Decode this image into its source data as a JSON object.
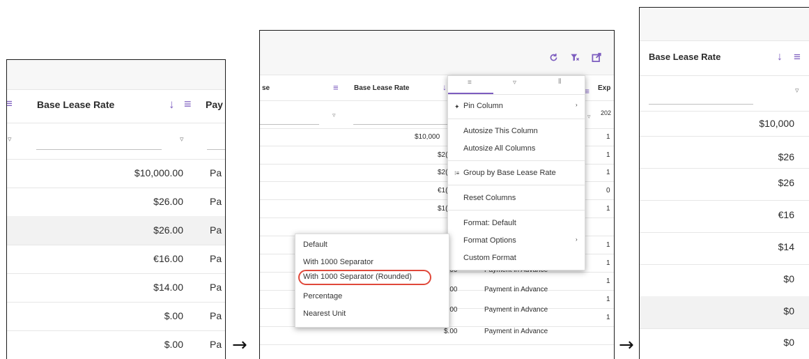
{
  "colors": {
    "accent": "#7c5cbf",
    "highlight_oval": "#e0483a"
  },
  "panel1": {
    "header": {
      "col_fragment_left": "≡",
      "col_title": "Base Lease Rate",
      "sort_icon": "↓",
      "menu_icon": "≡",
      "next_col": "Pay"
    },
    "values": [
      "$10,000.00",
      "$26.00",
      "$26.00",
      "€16.00",
      "$14.00",
      "$.00",
      "$.00"
    ],
    "next_col_values": [
      "Pa",
      "Pa",
      "Pa",
      "Pa",
      "Pa",
      "Pa",
      "Pa"
    ]
  },
  "arrow1": "→",
  "panel2": {
    "header": {
      "prev_col_fragment": "se",
      "col_title": "Base Lease Rate",
      "next_col": "Exp",
      "filter_value": "202"
    },
    "truncated_values": [
      "$10,000",
      "$2(",
      "$2(",
      "€1(",
      "$1("
    ],
    "next_col_values": [
      "1",
      "1",
      "1",
      "0",
      "1",
      "1",
      "1",
      "1",
      "1",
      "1"
    ],
    "lower_rows": [
      {
        "value": "$.00",
        "col": "Payment in Advance"
      },
      {
        "value": "$.00",
        "col": "Payment in Advance"
      },
      {
        "value": "$.00",
        "col": "Payment in Advance"
      },
      {
        "value": "$.00",
        "col": "Payment in Advance"
      }
    ],
    "column_menu": {
      "items": [
        {
          "label": "Pin Column",
          "icon": "pin-icon"
        },
        {
          "label": "Autosize This Column"
        },
        {
          "label": "Autosize All Columns"
        },
        {
          "label": "Group by Base Lease Rate",
          "icon": "group-icon"
        },
        {
          "label": "Reset Columns"
        },
        {
          "label": "Format: Default"
        },
        {
          "label": "Format Options"
        },
        {
          "label": "Custom Format"
        }
      ]
    },
    "format_submenu": {
      "items": [
        "Default",
        "With 1000 Separator",
        "With 1000 Separator (Rounded)",
        "Percentage",
        "Nearest Unit"
      ],
      "highlighted": "With 1000 Separator (Rounded)"
    }
  },
  "arrow2": "→",
  "panel3": {
    "header": {
      "col_title": "Base Lease Rate",
      "sort_icon": "↓",
      "menu_icon": "≡"
    },
    "values": [
      "$10,000",
      "$26",
      "$26",
      "€16",
      "$14",
      "$0",
      "$0",
      "$0"
    ]
  }
}
